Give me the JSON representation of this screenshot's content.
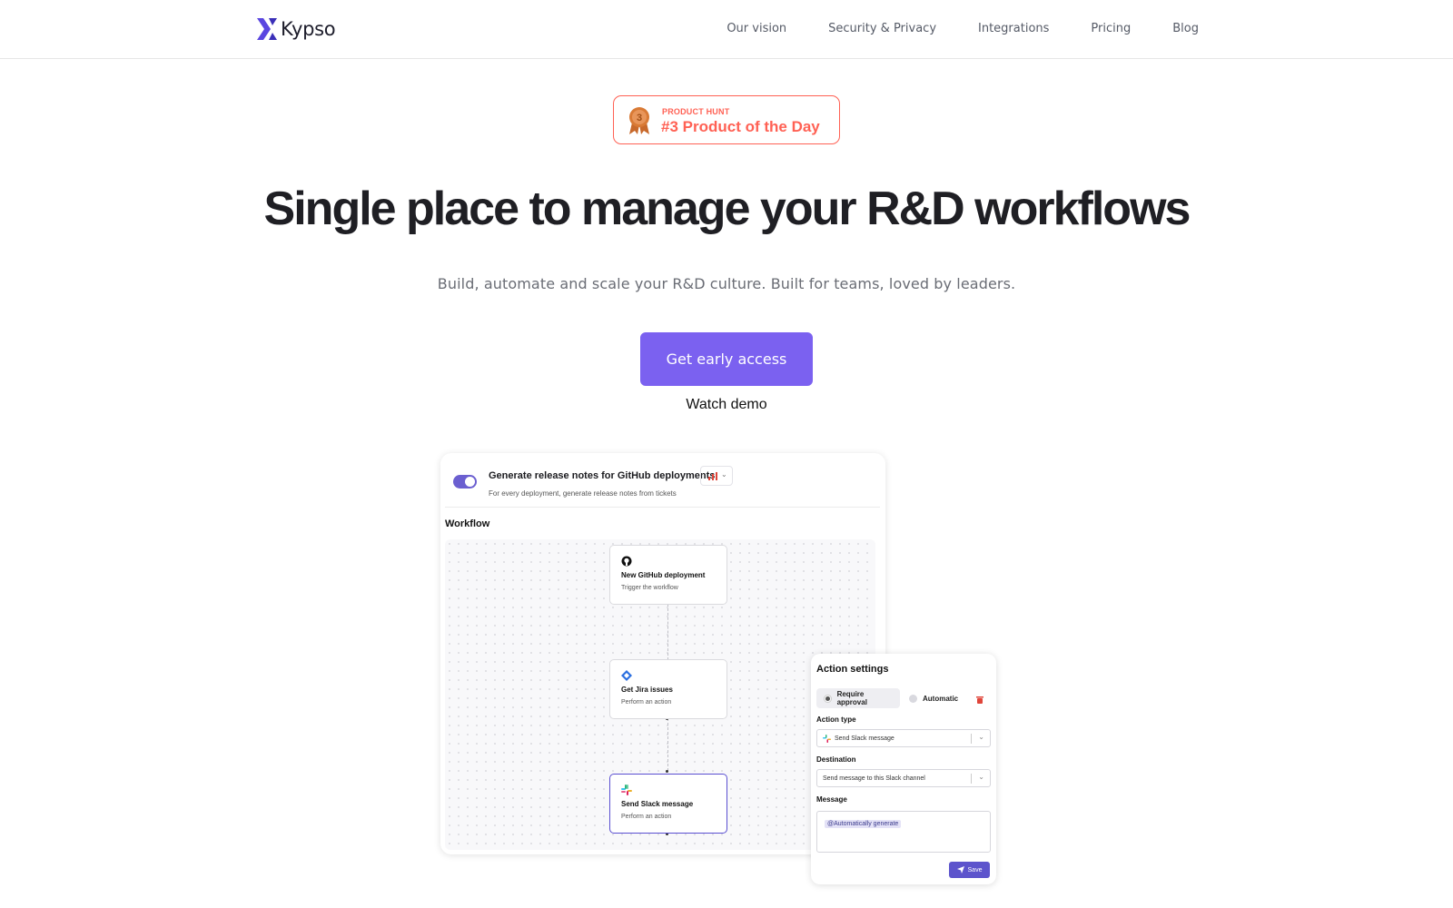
{
  "nav": {
    "brand": "Kypso",
    "links": [
      "Our vision",
      "Security & Privacy",
      "Integrations",
      "Pricing",
      "Blog"
    ]
  },
  "badge": {
    "medal_number": "3",
    "kicker": "PRODUCT HUNT",
    "title": "#3 Product of the Day",
    "color": "#ff6154"
  },
  "hero": {
    "title": "Single place to manage your R&D workflows",
    "subtitle": "Build, automate and scale your R&D culture. Built for teams, loved by leaders.",
    "cta_label": "Get early access",
    "secondary_label": "Watch demo",
    "accent": "#7b61f0"
  },
  "workflow_card": {
    "title": "Generate release notes for GitHub deployments",
    "description": "For every deployment, generate release notes from tickets",
    "enabled": true,
    "section_heading": "Workflow",
    "nodes": [
      {
        "icon": "github-icon",
        "title": "New GitHub deployment",
        "subtitle": "Trigger the workflow"
      },
      {
        "icon": "jira-icon",
        "title": "Get Jira issues",
        "subtitle": "Perform an action"
      },
      {
        "icon": "slack-icon",
        "title": "Send Slack message",
        "subtitle": "Perform an action"
      }
    ]
  },
  "action_settings": {
    "title": "Action settings",
    "mode_options": [
      "Require approval",
      "Automatic"
    ],
    "selected_mode": "Require approval",
    "action_type_label": "Action type",
    "action_type_value": "Send Slack message",
    "destination_label": "Destination",
    "destination_value": "Send message to this Slack channel",
    "message_label": "Message",
    "message_tag": "@Automatically generate",
    "save_label": "Save"
  }
}
